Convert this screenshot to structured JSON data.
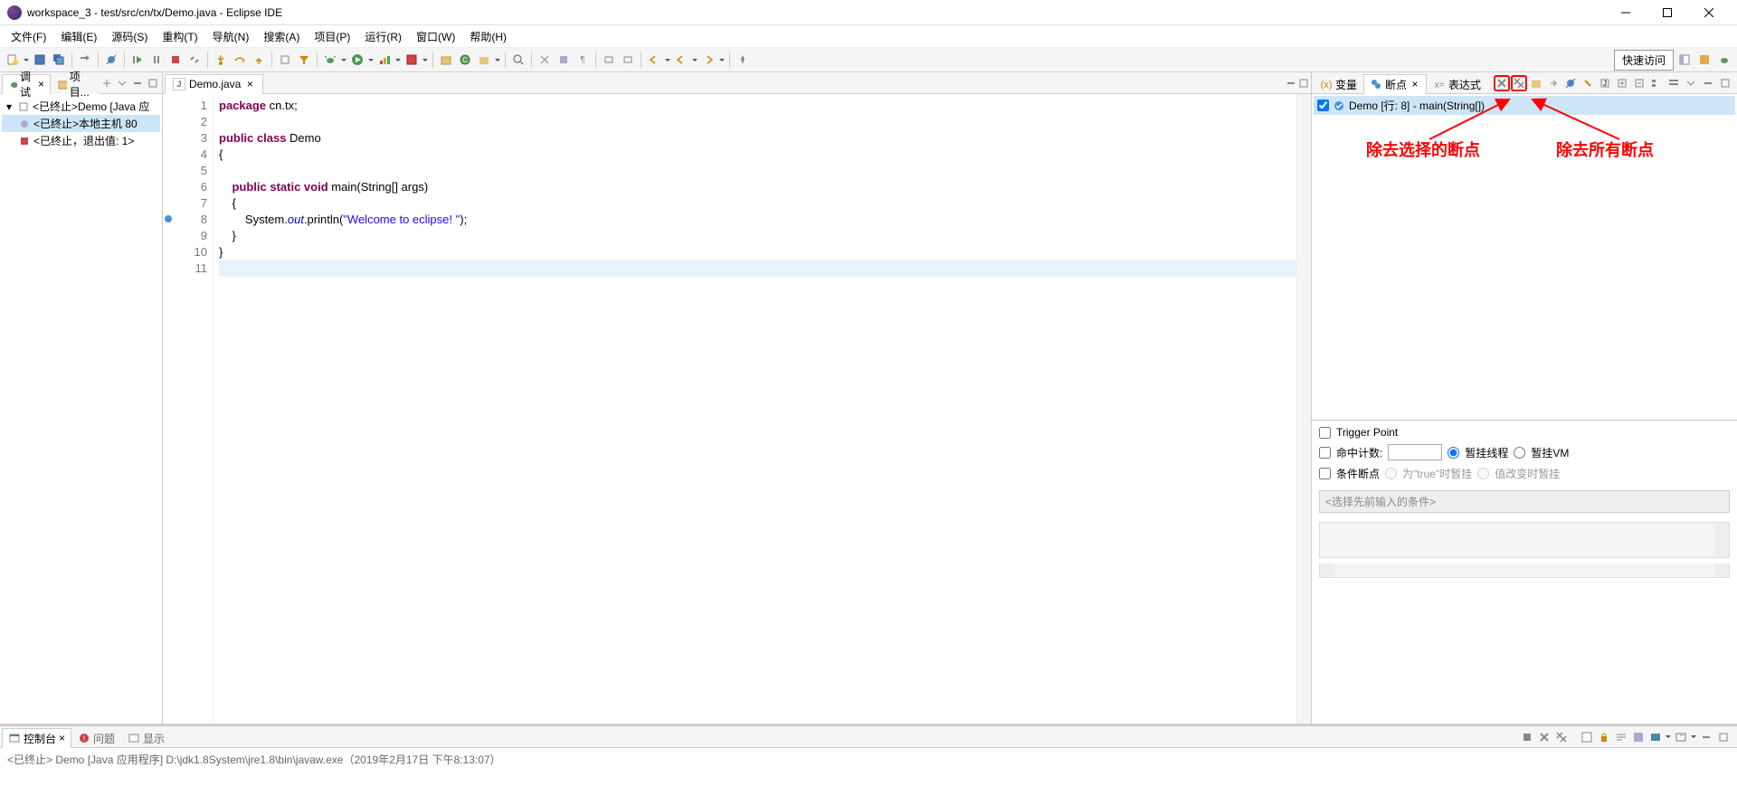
{
  "window": {
    "title": "workspace_3 - test/src/cn/tx/Demo.java - Eclipse IDE"
  },
  "menu": [
    "文件(F)",
    "编辑(E)",
    "源码(S)",
    "重构(T)",
    "导航(N)",
    "搜索(A)",
    "项目(P)",
    "运行(R)",
    "窗口(W)",
    "帮助(H)"
  ],
  "toolbar": {
    "quick_access": "快速访问"
  },
  "debug_view": {
    "tab_debug": "调试",
    "tab_project": "项目...",
    "tree": [
      {
        "level": 0,
        "text": "<已终止>Demo [Java 应",
        "selected": false,
        "expand": "▾"
      },
      {
        "level": 1,
        "text": "<已终止>本地主机 80",
        "selected": true
      },
      {
        "level": 1,
        "text": "<已终止，退出值: 1>",
        "selected": false
      }
    ]
  },
  "editor": {
    "tab_name": "Demo.java",
    "lines": [
      {
        "n": 1,
        "html": "<span class='kw'>package</span> cn.tx;"
      },
      {
        "n": 2,
        "html": ""
      },
      {
        "n": 3,
        "html": "<span class='kw'>public class</span> Demo"
      },
      {
        "n": 4,
        "html": "{"
      },
      {
        "n": 5,
        "html": ""
      },
      {
        "n": 6,
        "html": "    <span class='kw'>public static void</span> main(String[] args)",
        "marker": "method"
      },
      {
        "n": 7,
        "html": "    {"
      },
      {
        "n": 8,
        "html": "        System.<span class='field'>out</span>.println(<span class='str'>\"Welcome to eclipse! \"</span>);",
        "marker": "bp"
      },
      {
        "n": 9,
        "html": "    }"
      },
      {
        "n": 10,
        "html": "}"
      },
      {
        "n": 11,
        "html": "",
        "current": true
      }
    ]
  },
  "breakpoints_view": {
    "tab_variables": "变量",
    "tab_breakpoints": "断点",
    "tab_expressions": "表达式",
    "item": "Demo [行:  8] - main(String[])",
    "annotation1": "除去选择的断点",
    "annotation2": "除去所有断点",
    "trigger_point": "Trigger Point",
    "hit_count": "命中计数:",
    "suspend_thread": "暂挂线程",
    "suspend_vm": "暂挂VM",
    "conditional": "条件断点",
    "when_true": "为\"true\"时暂挂",
    "when_changed": "值改变时暂挂",
    "cond_placeholder": "<选择先前输入的条件>"
  },
  "console": {
    "tab_console": "控制台",
    "tab_problems": "问题",
    "tab_display": "显示",
    "status_line": "<已终止> Demo [Java 应用程序] D:\\jdk1.8System\\jre1.8\\bin\\javaw.exe（2019年2月17日 下午8:13:07）"
  }
}
